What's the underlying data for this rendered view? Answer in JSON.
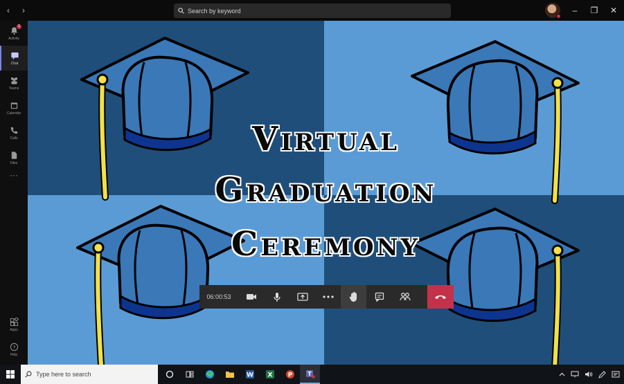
{
  "titlebar": {
    "search_placeholder": "Search by keyword",
    "back": "‹",
    "forward": "›",
    "minimize": "–",
    "restore": "❐",
    "close": "✕"
  },
  "rail": {
    "items": [
      {
        "label": "Activity",
        "icon": "bell-icon",
        "badge": "1"
      },
      {
        "label": "Chat",
        "icon": "chat-icon"
      },
      {
        "label": "Teams",
        "icon": "teams-icon"
      },
      {
        "label": "Calendar",
        "icon": "calendar-icon"
      },
      {
        "label": "Calls",
        "icon": "phone-icon"
      },
      {
        "label": "Files",
        "icon": "files-icon"
      }
    ],
    "more": "···",
    "bottom": [
      {
        "label": "Apps",
        "icon": "apps-icon"
      },
      {
        "label": "Help",
        "icon": "help-icon"
      }
    ]
  },
  "stage": {
    "title_lines": [
      "Virtual",
      "Graduation",
      "Ceremony"
    ],
    "colors": {
      "dark": "#1f4e7a",
      "light": "#5b9bd5",
      "cap": "#3a78b8",
      "tassel": "#f2e04a"
    }
  },
  "controls": {
    "timer": "06:00:53",
    "buttons": [
      "camera-icon",
      "microphone-icon",
      "share-screen-icon",
      "more-icon",
      "raise-hand-icon",
      "chat-icon",
      "participants-icon",
      "hang-up-icon"
    ]
  },
  "taskbar": {
    "search_placeholder": "Type here to search",
    "apps": [
      "cortana-icon",
      "task-view-icon",
      "edge-icon",
      "file-explorer-icon",
      "word-icon",
      "excel-icon",
      "powerpoint-icon",
      "teams-icon"
    ],
    "tray": [
      "chevron-up-icon",
      "network-icon",
      "volume-icon",
      "pen-icon",
      "notification-icon"
    ]
  }
}
